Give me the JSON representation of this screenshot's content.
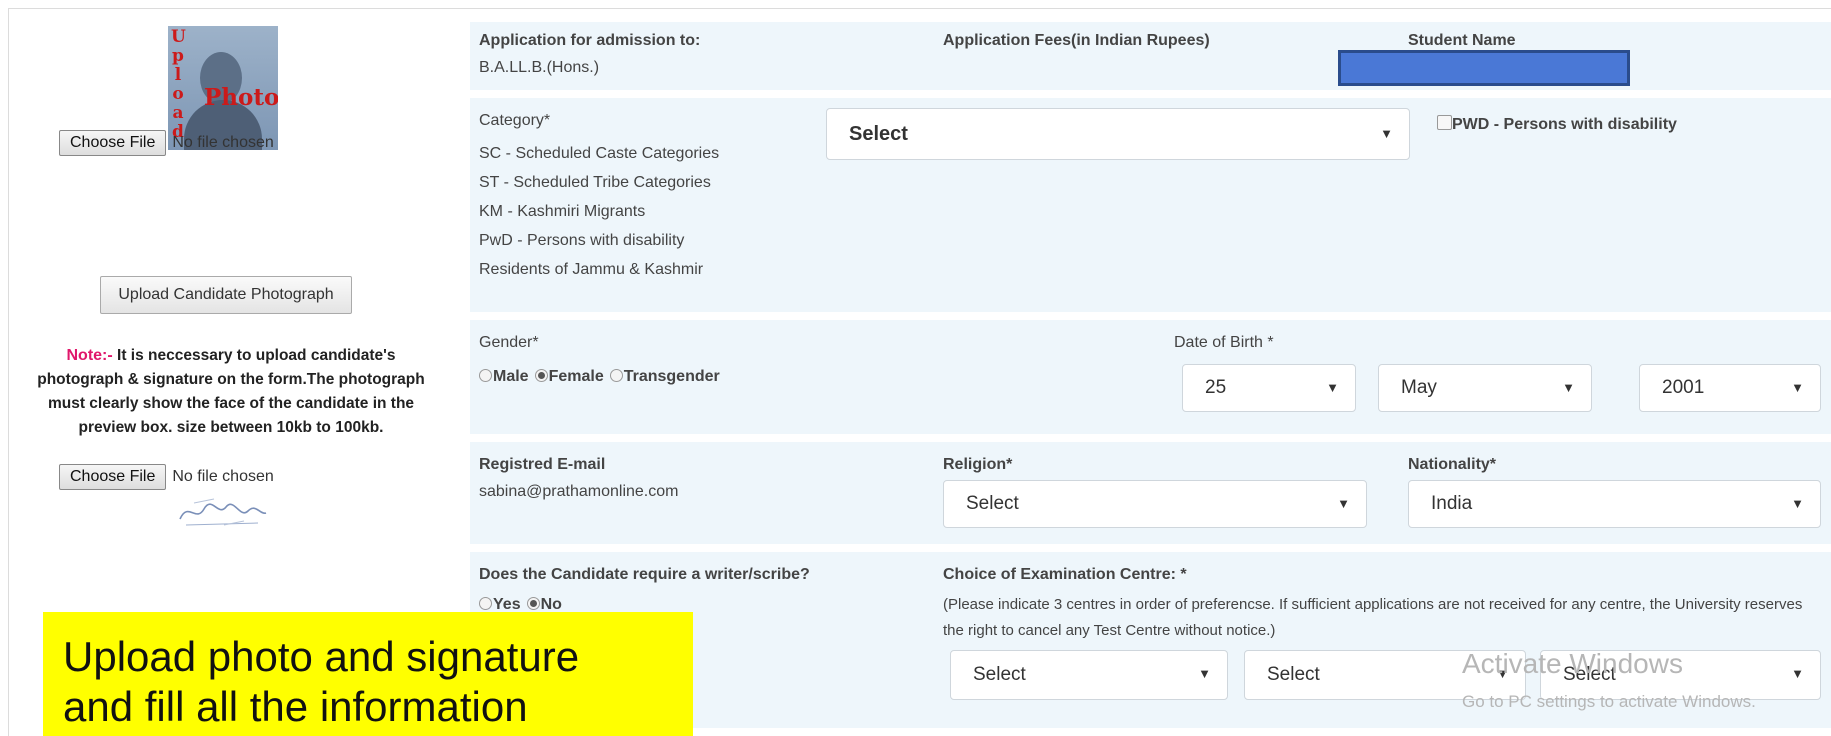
{
  "left": {
    "photo": {
      "vertical_text": "Upload",
      "text": "Photo"
    },
    "file1": {
      "button": "Choose File",
      "status": "No file chosen"
    },
    "upload_button": "Upload Candidate Photograph",
    "note_label": "Note:-",
    "note_text": " It is neccessary to upload candidate's photograph & signature on the form.The photograph must clearly show the face of the candidate in the preview box. size between 10kb to 100kb.",
    "file2": {
      "button": "Choose File",
      "status": "No file chosen"
    }
  },
  "overlay": {
    "line1": "Upload photo and signature",
    "line2": "and fill all the information"
  },
  "row1": {
    "admission_label": "Application for admission to:",
    "admission_value": "B.A.LL.B.(Hons.)",
    "fees_label": "Application Fees(in Indian Rupees)",
    "student_label": "Student Name"
  },
  "row2": {
    "category_label": "Category*",
    "category_items": [
      "SC - Scheduled Caste Categories",
      "ST - Scheduled Tribe Categories",
      "KM - Kashmiri Migrants",
      "PwD - Persons with disability",
      "Residents of Jammu & Kashmir"
    ],
    "category_select": "Select",
    "pwd_label": "PWD - Persons with disability"
  },
  "row3": {
    "gender_label": "Gender*",
    "gender_options": [
      "Male",
      "Female",
      "Transgender"
    ],
    "dob_label": "Date of Birth *",
    "dob_day": "25",
    "dob_month": "May",
    "dob_year": "2001"
  },
  "row4": {
    "email_label": "Registred E-mail",
    "email_value": "sabina@prathamonline.com",
    "religion_label": "Religion*",
    "religion_select": "Select",
    "nationality_label": "Nationality*",
    "nationality_select": "India"
  },
  "row5": {
    "scribe_label": "Does the Candidate require a writer/scribe?",
    "scribe_options": [
      "Yes",
      "No"
    ],
    "centre_label": "Choice of Examination Centre: *",
    "centre_note": "(Please indicate 3 centres in order of preferencse. If sufficient applications are not received for any centre, the University reserves the right to cancel any Test Centre without notice.)",
    "centre1": "Select",
    "centre2": "Select",
    "centre3": "Select"
  },
  "watermark": {
    "title": "Activate Windows",
    "subtitle": "Go to PC settings to activate Windows."
  },
  "colors": {
    "panel_bg": "#eef6fb",
    "highlight": "#ffff00",
    "note_label": "#e0176b",
    "name_redaction": "#4a78d6"
  }
}
